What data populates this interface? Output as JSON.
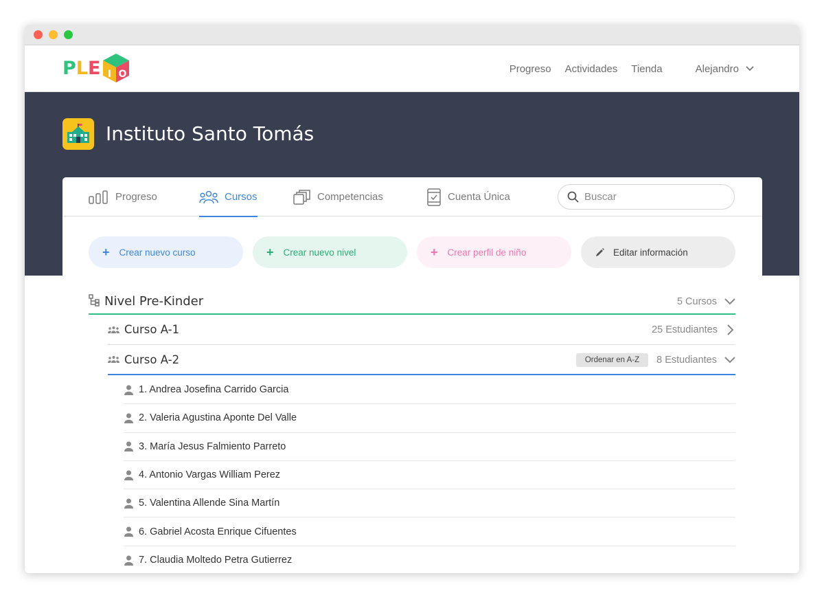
{
  "app": {
    "logo_letters": [
      "P",
      "L",
      "E"
    ],
    "logo_cube_letters": [
      "I",
      "O"
    ],
    "colors": {
      "banner": "#393e50",
      "accent_blue": "#3f86e0",
      "accent_green": "#2ebf86",
      "accent_pink": "#ee77b2",
      "logo_yellow": "#f6c21c"
    }
  },
  "topnav": {
    "links": [
      "Progreso",
      "Actividades",
      "Tienda"
    ],
    "user_name": "Alejandro"
  },
  "banner": {
    "school_icon": "school-building-icon",
    "school_name": "Instituto Santo Tomás"
  },
  "tabs": {
    "items": [
      {
        "label": "Progreso",
        "icon": "bar-chart-icon",
        "active": false
      },
      {
        "label": "Cursos",
        "icon": "people-group-icon",
        "active": true
      },
      {
        "label": "Competencias",
        "icon": "stacked-cards-icon",
        "active": false
      },
      {
        "label": "Cuenta Única",
        "icon": "tablet-check-icon",
        "active": false
      }
    ],
    "search_placeholder": "Buscar"
  },
  "actions": {
    "new_course": "Crear nuevo curso",
    "new_level": "Crear nuevo nivel",
    "new_child_profile": "Crear perfil de niño",
    "edit_info": "Editar información",
    "plus_glyph": "+"
  },
  "level": {
    "title": "Nivel Pre-Kinder",
    "count": "5 Cursos"
  },
  "courses": [
    {
      "title": "Curso A-1",
      "count": "25 Estudiantes",
      "expanded": false
    },
    {
      "title": "Curso A-2",
      "count": "8 Estudiantes",
      "expanded": true,
      "sort_label": "Ordenar en A-Z"
    }
  ],
  "students": [
    "1. Andrea Josefina Carrido Garcia",
    "2. Valeria Agustina Aponte Del Valle",
    "3. María Jesus Falmiento Parreto",
    "4. Antonio Vargas William Perez",
    "5. Valentina Allende Sina Martín",
    "6. Gabriel Acosta Enrique Cifuentes",
    "7. Claudia Moltedo Petra Gutierrez"
  ]
}
